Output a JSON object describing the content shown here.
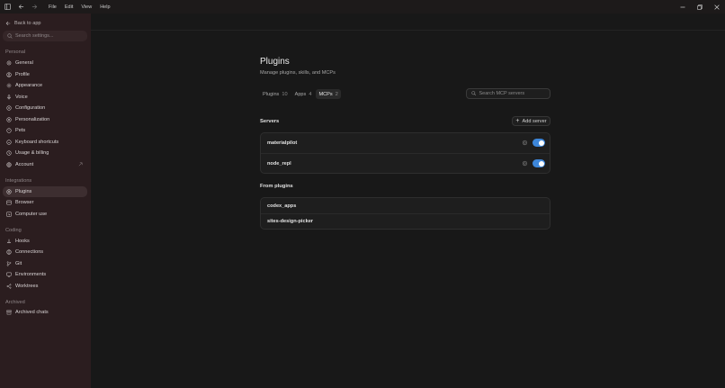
{
  "menu": [
    "File",
    "Edit",
    "View",
    "Help"
  ],
  "sidebar": {
    "back_label": "Back to app",
    "search_placeholder": "Search settings...",
    "sections": {
      "personal": "Personal",
      "integrations": "Integrations",
      "coding": "Coding",
      "archived": "Archived"
    },
    "items": {
      "general": "General",
      "profile": "Profile",
      "appearance": "Appearance",
      "voice": "Voice",
      "configuration": "Configuration",
      "personalization": "Personalization",
      "pets": "Pets",
      "keyboard_shortcuts": "Keyboard shortcuts",
      "usage_billing": "Usage & billing",
      "account": "Account",
      "plugins": "Plugins",
      "browser": "Browser",
      "computer_use": "Computer use",
      "hooks": "Hooks",
      "connections": "Connections",
      "git": "Git",
      "environments": "Environments",
      "worktrees": "Worktrees",
      "archived_chats": "Archived chats"
    }
  },
  "main": {
    "title": "Plugins",
    "subtitle": "Manage plugins, skills, and MCPs",
    "tabs": [
      {
        "label": "Plugins",
        "count": "10"
      },
      {
        "label": "Apps",
        "count": "4"
      },
      {
        "label": "MCPs",
        "count": "2"
      }
    ],
    "active_tab": "MCPs",
    "search_placeholder": "Search MCP servers",
    "servers_heading": "Servers",
    "add_server_label": "Add server",
    "servers": [
      {
        "name": "materialpilot",
        "enabled": true
      },
      {
        "name": "node_repl",
        "enabled": true
      }
    ],
    "from_plugins_heading": "From plugins",
    "plugin_servers": [
      {
        "name": "codex_apps"
      },
      {
        "name": "sites-design-picker"
      }
    ]
  },
  "colors": {
    "sidebar_bg": "#2b1d1f",
    "main_bg": "#181818",
    "toggle_on": "#3d86d9",
    "active_nav": "#3d2e30"
  }
}
